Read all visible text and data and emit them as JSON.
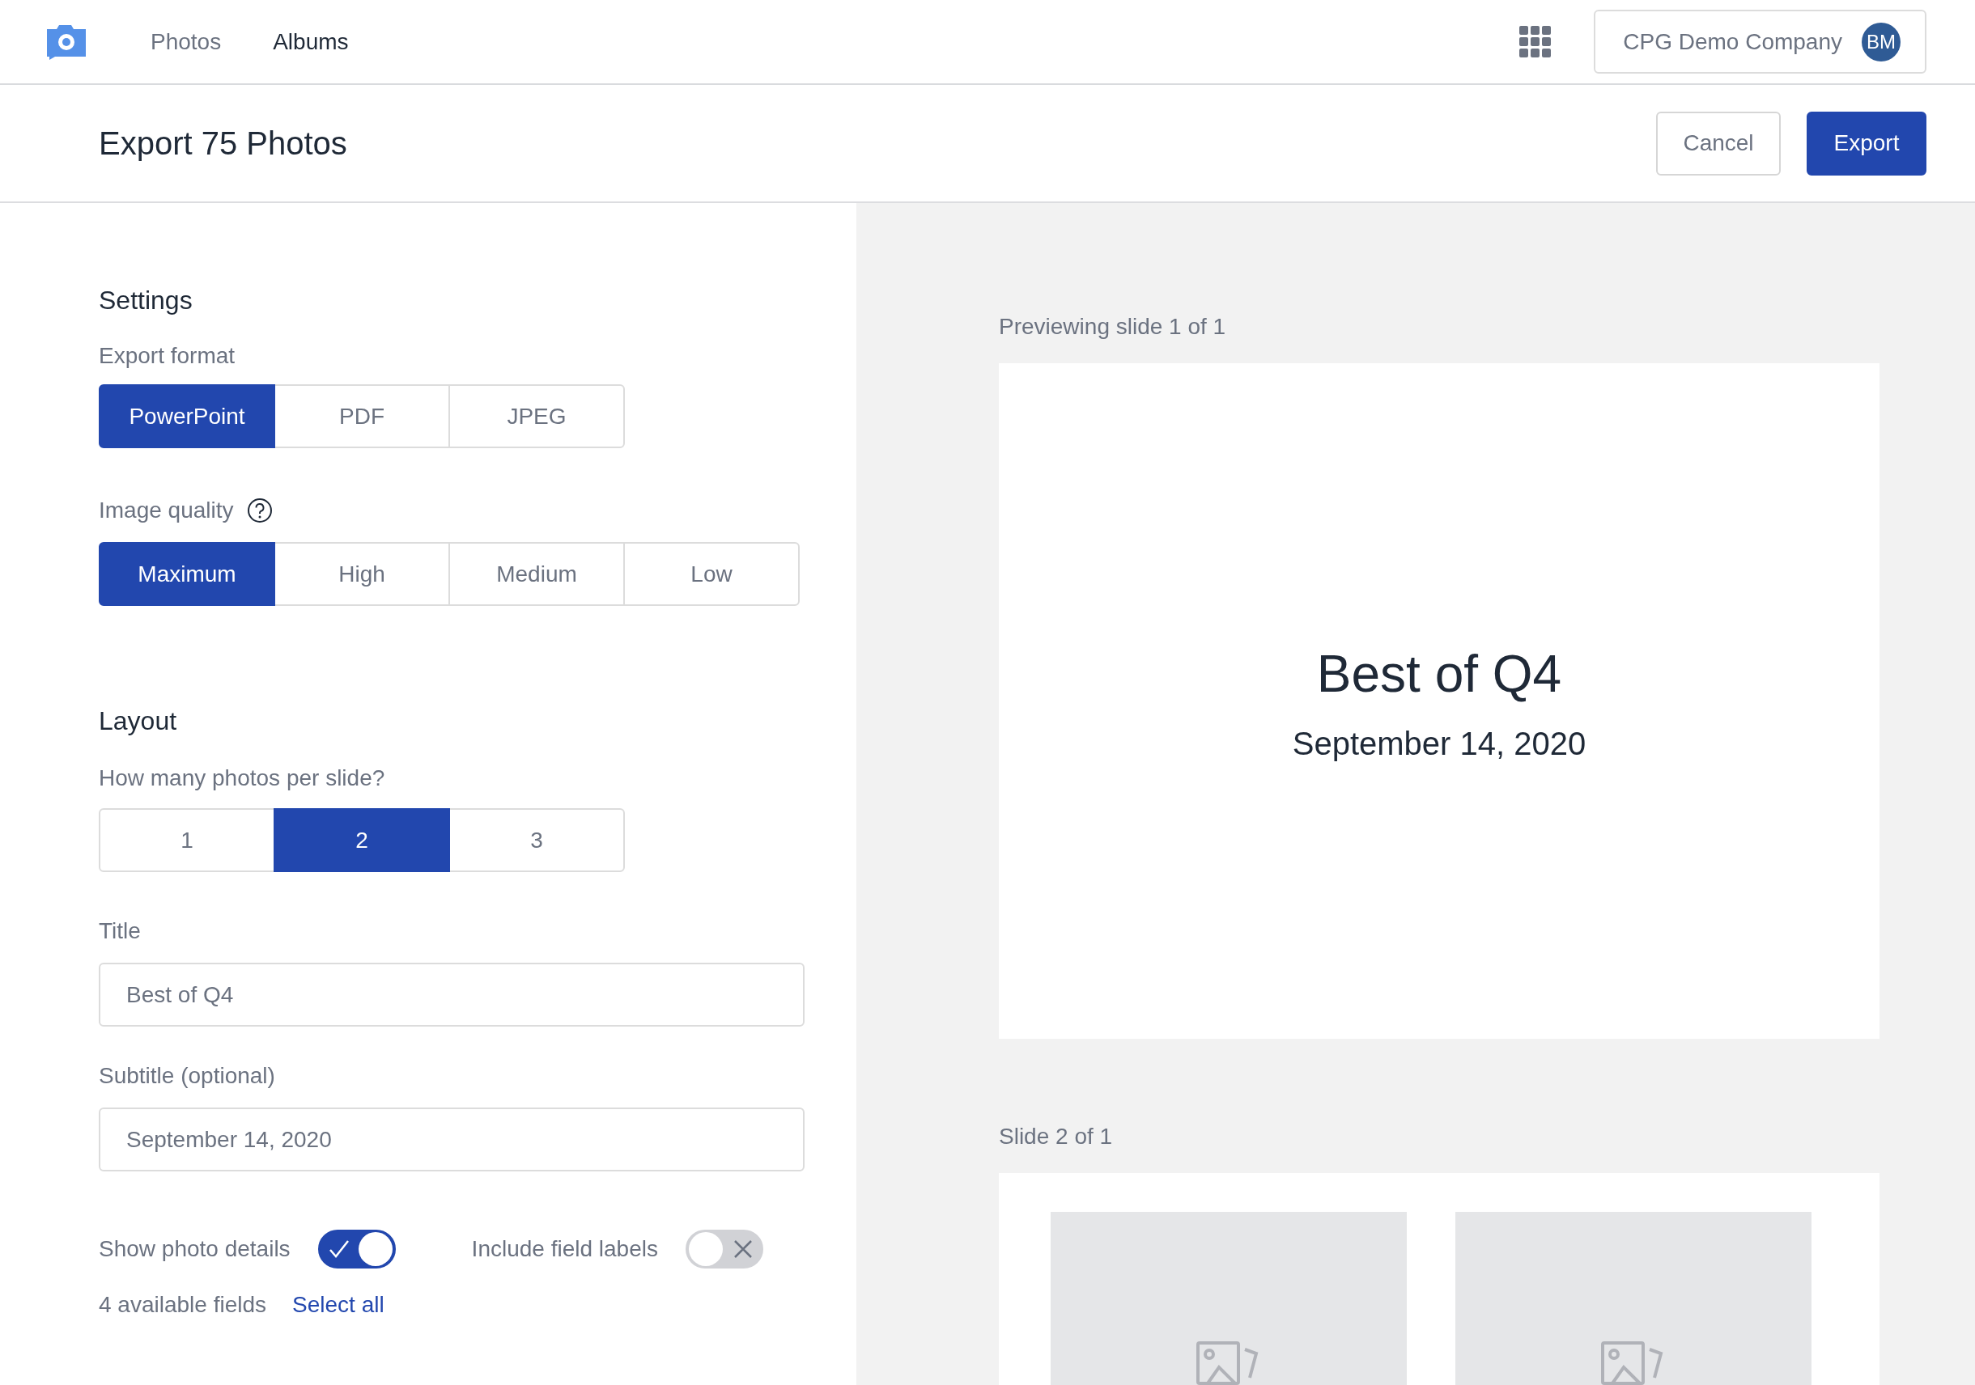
{
  "nav": {
    "items": [
      {
        "label": "Photos",
        "selected": false
      },
      {
        "label": "Albums",
        "selected": true
      }
    ],
    "account": {
      "company": "CPG Demo Company",
      "initials": "BM"
    }
  },
  "header": {
    "title": "Export 75 Photos",
    "buttons": [
      {
        "label": "Cancel",
        "kind": "secondary"
      },
      {
        "label": "Export",
        "kind": "primary"
      }
    ]
  },
  "settings": {
    "heading": "Settings",
    "export_format": {
      "label": "Export format",
      "options": [
        {
          "label": "PowerPoint",
          "selected": true
        },
        {
          "label": "PDF",
          "selected": false
        },
        {
          "label": "JPEG",
          "selected": false
        }
      ]
    },
    "image_quality": {
      "label": "Image quality",
      "options": [
        {
          "label": "Maximum",
          "selected": true
        },
        {
          "label": "High",
          "selected": false
        },
        {
          "label": "Medium",
          "selected": false
        },
        {
          "label": "Low",
          "selected": false
        }
      ]
    }
  },
  "layout": {
    "heading": "Layout",
    "photos_per_slide": {
      "label": "How many photos per slide?",
      "options": [
        {
          "label": "1",
          "selected": false
        },
        {
          "label": "2",
          "selected": true
        },
        {
          "label": "3",
          "selected": false
        }
      ]
    },
    "title_field": {
      "label": "Title",
      "value": "Best of Q4"
    },
    "subtitle_field": {
      "label": "Subtitle (optional)",
      "value": "September 14, 2020"
    },
    "toggles": [
      {
        "label": "Show photo details",
        "on": true
      },
      {
        "label": "Include field labels",
        "on": false
      }
    ],
    "fields_count": "4 available fields",
    "select_all": "Select all"
  },
  "preview": {
    "caption": "Previewing slide 1 of 1",
    "slide_title": "Best of Q4",
    "slide_subtitle": "September 14, 2020",
    "slide2_caption": "Slide 2 of 1",
    "photo_slots": [
      {
        "kind": "placeholder"
      },
      {
        "kind": "placeholder"
      }
    ]
  }
}
